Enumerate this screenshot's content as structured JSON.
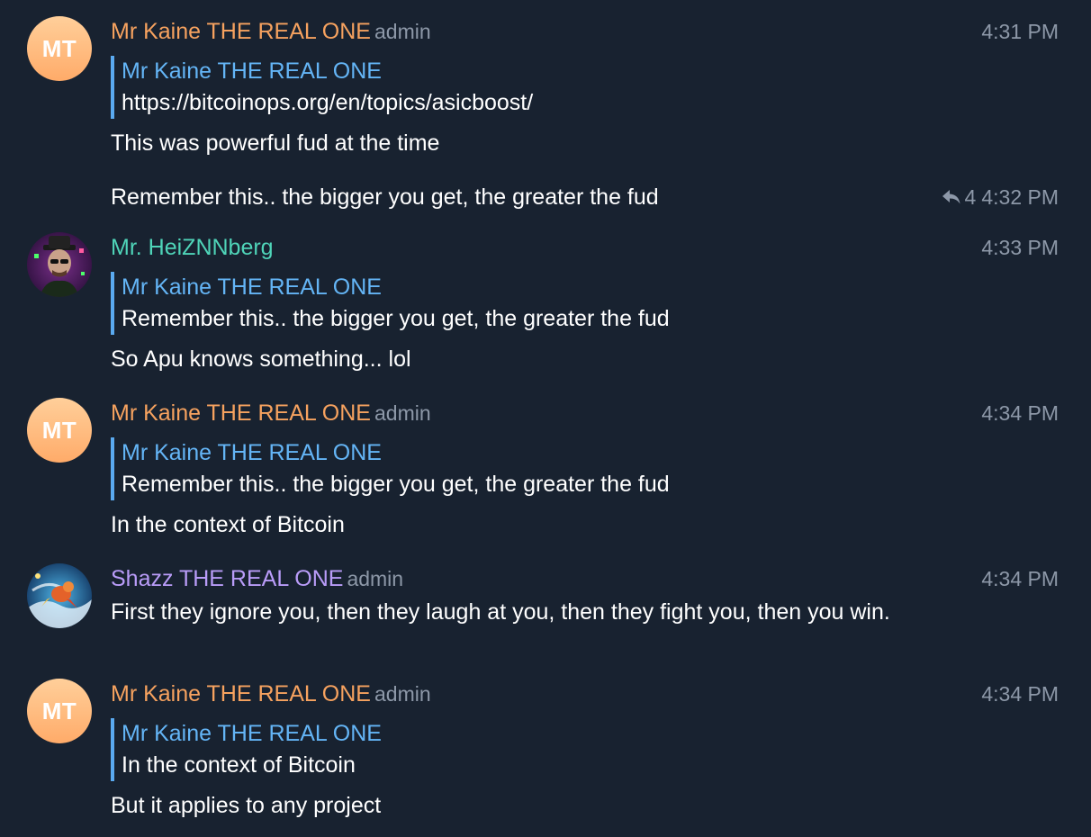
{
  "colors": {
    "background": "#182230",
    "orange_name": "#f6a25f",
    "teal_name": "#4fd4b8",
    "purple_name": "#b99cf8",
    "reply_accent": "#5aaaf0",
    "muted": "#8d98a8"
  },
  "messages": [
    {
      "avatar_initials": "MT",
      "sender": "Mr Kaine THE REAL ONE",
      "role": "admin",
      "time": "4:31 PM",
      "reply_to_name": "Mr Kaine THE REAL ONE",
      "reply_to_text": "https://bitcoinops.org/en/topics/asicboost/",
      "text": "This was powerful fud at the time"
    },
    {
      "text": "Remember this.. the bigger you get, the greater the fud",
      "reply_count": "4",
      "reply_icon": "reply-arrow-icon",
      "time": "4:32 PM"
    },
    {
      "sender": "Mr. HeiZNNberg",
      "time": "4:33 PM",
      "reply_to_name": "Mr Kaine THE REAL ONE",
      "reply_to_text": "Remember this.. the bigger you get, the greater the fud",
      "text": "So Apu knows something... lol"
    },
    {
      "avatar_initials": "MT",
      "sender": "Mr Kaine THE REAL ONE",
      "role": "admin",
      "time": "4:34 PM",
      "reply_to_name": "Mr Kaine THE REAL ONE",
      "reply_to_text": "Remember this.. the bigger you get, the greater the fud",
      "text": "In the context of Bitcoin"
    },
    {
      "sender": "Shazz THE REAL ONE",
      "role": "admin",
      "time": "4:34 PM",
      "text": "First they ignore you, then they laugh at you, then they fight you, then you win."
    },
    {
      "avatar_initials": "MT",
      "sender": "Mr Kaine THE REAL ONE",
      "role": "admin",
      "time": "4:34 PM",
      "reply_to_name": "Mr Kaine THE REAL ONE",
      "reply_to_text": "In the context of Bitcoin",
      "text": "But it applies to any project"
    }
  ]
}
